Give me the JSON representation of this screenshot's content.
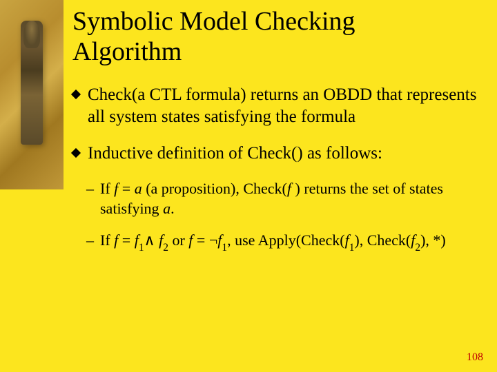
{
  "title_line1": "Symbolic Model Checking",
  "title_line2": "Algorithm",
  "bullet1": {
    "part1": "Check(a CTL formula) returns an OBDD that represents all system states satisfying the formula"
  },
  "bullet2": {
    "part1": "Inductive definition of Check() as follows:"
  },
  "sub1": {
    "prefix": "If ",
    "f": "f",
    "eq": " = ",
    "a": "a",
    "mid": " (a proposition), Check(",
    "f2": "f ",
    "mid2": ") returns the set of states satisfying ",
    "a2": "a",
    "end": "."
  },
  "sub2": {
    "prefix": "If ",
    "f": "f",
    "eq": " = ",
    "f1": "f",
    "sub1": "1",
    "wedge": "∧ ",
    "f2": "f",
    "sub2": "2",
    "or": " or ",
    "f3": "f",
    "eq2": " = ",
    "neg": "¬",
    "f4": "f",
    "sub1b": "1",
    "mid": ", use Apply(Check(",
    "f5": "f",
    "sub1c": "1",
    "mid2": "), Check(",
    "f6": "f",
    "sub2b": "2",
    "end": "), *)"
  },
  "page_number": "108"
}
